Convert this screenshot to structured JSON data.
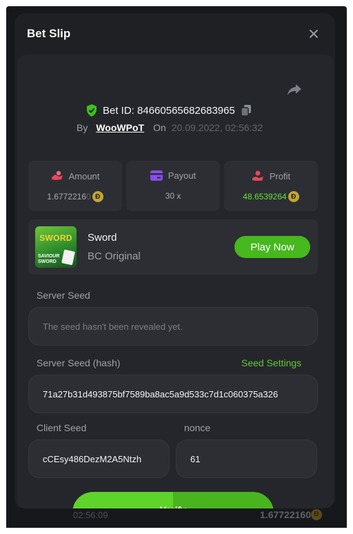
{
  "dialog": {
    "title": "Bet Slip",
    "bet_id": "Bet ID: 84660565682683965",
    "by_label": "By",
    "user": "WooWPoT",
    "on_label": "On",
    "date": "20.09.2022, 02:56:32"
  },
  "stats": {
    "amount": {
      "label": "Amount",
      "value": "1.6772216",
      "value_dim": "0",
      "coin": "Ð",
      "icon": "hand-coin-icon"
    },
    "payout": {
      "label": "Payout",
      "value": "30 x",
      "icon": "card-icon"
    },
    "profit": {
      "label": "Profit",
      "value": "48.6539264",
      "coin": "Ð",
      "icon": "user-hand-icon"
    }
  },
  "game": {
    "name": "Sword",
    "provider": "BC Original",
    "play_label": "Play Now",
    "thumb_title": "SWORD",
    "thumb_caption": "SAVIOUR SWORD"
  },
  "seeds": {
    "server_label": "Server Seed",
    "server_value": "The seed hasn't been revealed yet.",
    "hash_label": "Server Seed (hash)",
    "settings_label": "Seed Settings",
    "hash_value": "71a27b31d493875bf7589ba8ac5a9d533c7d1c060375a326",
    "client_label": "Client Seed",
    "client_value": "cCEsy486DezM2A5Ntzh",
    "nonce_label": "nonce",
    "nonce_value": "61"
  },
  "verify_label": "Verify",
  "background_row": {
    "time": "02:56:09",
    "amount": "1.6772216",
    "amount_dim": "0",
    "coin": "Ð"
  },
  "colors": {
    "accent_green": "#47b81e",
    "profit_green": "#5ee532",
    "panel": "#25262b",
    "card": "#2d2e33"
  }
}
